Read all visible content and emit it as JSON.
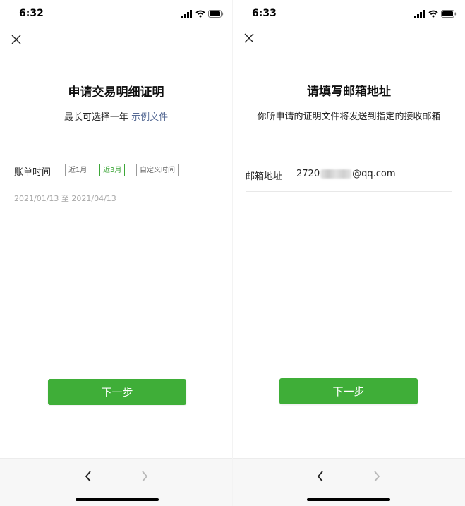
{
  "left": {
    "time": "6:32",
    "title": "申请交易明细证明",
    "subtitle_text": "最长可选择一年",
    "subtitle_link": "示例文件",
    "bill_time_label": "账单时间",
    "chips": [
      "近1月",
      "近3月",
      "自定义时间"
    ],
    "active_chip": "近3月",
    "date_range": "2021/01/13 至 2021/04/13",
    "next_button": "下一步"
  },
  "right": {
    "time": "6:33",
    "title": "请填写邮箱地址",
    "subtitle": "你所申请的证明文件将发送到指定的接收邮箱",
    "email_label": "邮箱地址",
    "email_prefix": "2720",
    "email_suffix": "@qq.com",
    "next_button": "下一步"
  },
  "nav": {
    "back_icon": "chevron-left-icon",
    "forward_icon": "chevron-right-icon"
  },
  "colors": {
    "accent": "#3fae38",
    "link": "#576b95",
    "chip_active": "#3da638"
  }
}
